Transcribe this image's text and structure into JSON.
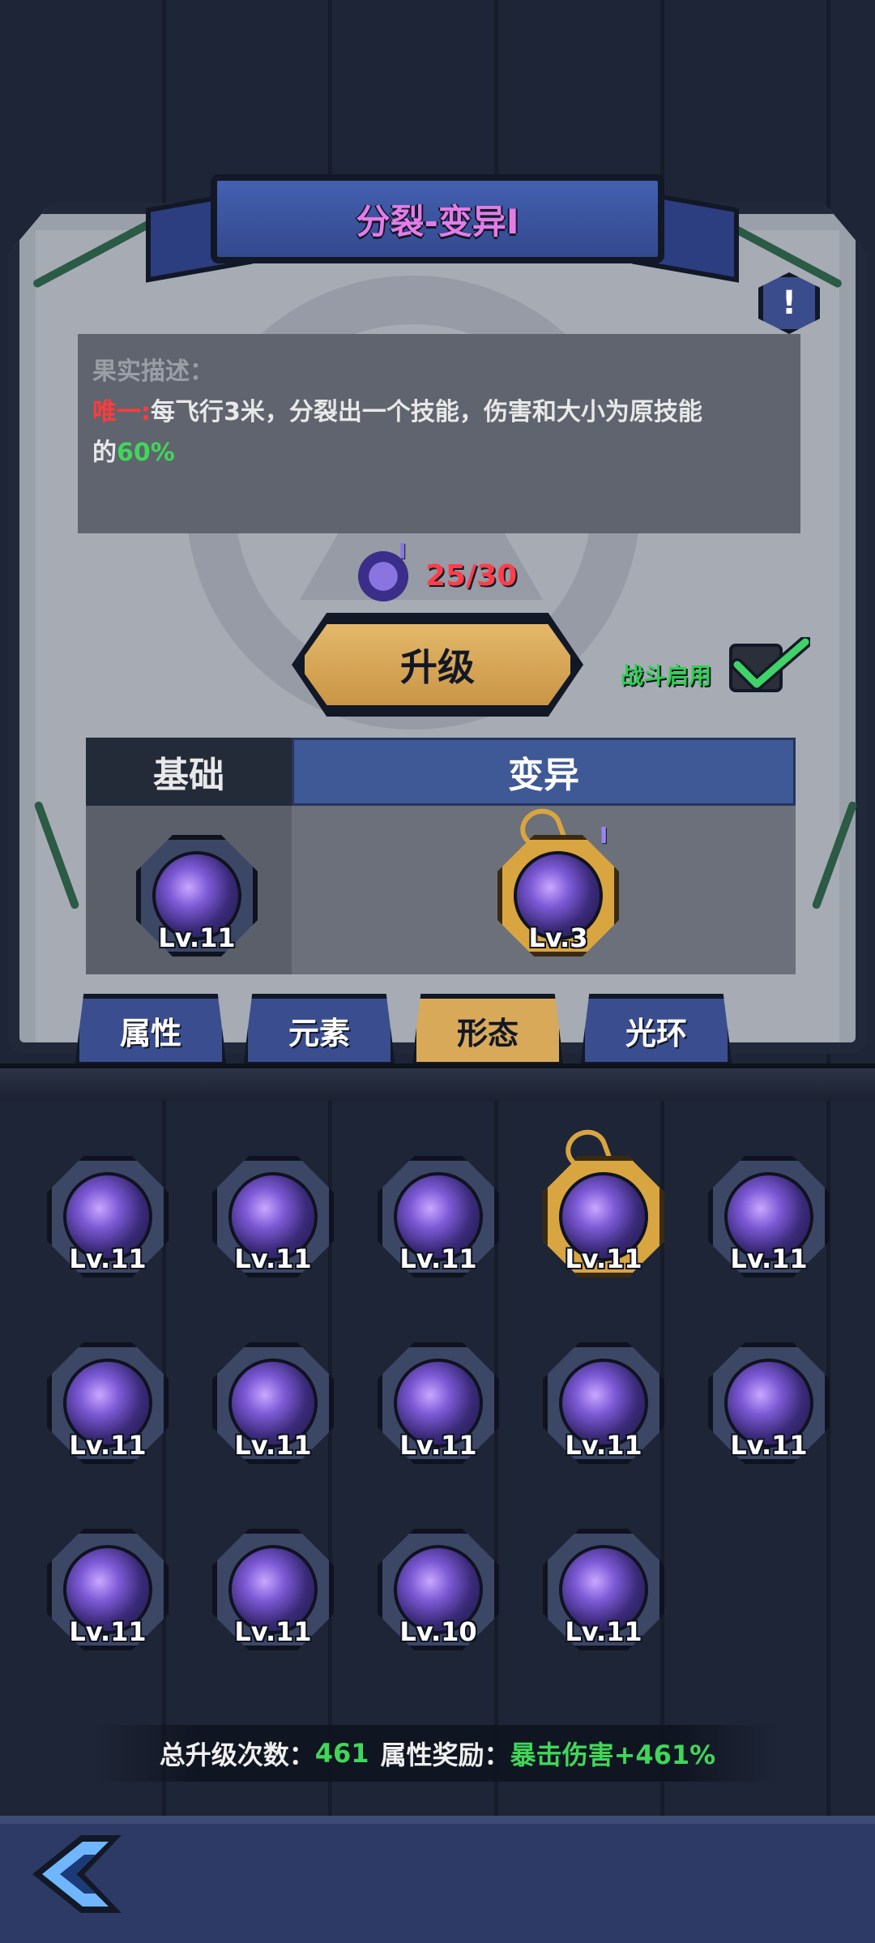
{
  "header": {
    "title": "分裂-变异I",
    "info_icon": "exclamation-icon"
  },
  "description": {
    "heading": "果实描述：",
    "tag": "唯一:",
    "text": "每飞行3米，分裂出一个技能，伤害和大小为原技能",
    "text_end_prefix": "的",
    "highlight": "60%"
  },
  "cost": {
    "icon": "mutation-gem-icon",
    "badge": "I",
    "value": "25/30"
  },
  "upgrade_button": {
    "label": "升级"
  },
  "battle_toggle": {
    "label": "战斗启用",
    "checked": true
  },
  "comparison": {
    "base_header": "基础",
    "mutation_header": "变异",
    "base_level": "Lv.11",
    "mutation_level": "Lv.3",
    "mutation_badge": "I"
  },
  "tabs": [
    {
      "label": "属性",
      "active": false
    },
    {
      "label": "元素",
      "active": false
    },
    {
      "label": "形态",
      "active": true
    },
    {
      "label": "光环",
      "active": false
    }
  ],
  "skills": [
    {
      "level": "Lv.11",
      "selected": false
    },
    {
      "level": "Lv.11",
      "selected": false
    },
    {
      "level": "Lv.11",
      "selected": false
    },
    {
      "level": "Lv.11",
      "selected": true
    },
    {
      "level": "Lv.11",
      "selected": false
    },
    {
      "level": "Lv.11",
      "selected": false
    },
    {
      "level": "Lv.11",
      "selected": false
    },
    {
      "level": "Lv.11",
      "selected": false
    },
    {
      "level": "Lv.11",
      "selected": false
    },
    {
      "level": "Lv.11",
      "selected": false
    },
    {
      "level": "Lv.11",
      "selected": false
    },
    {
      "level": "Lv.11",
      "selected": false
    },
    {
      "level": "Lv.10",
      "selected": false
    },
    {
      "level": "Lv.11",
      "selected": false
    }
  ],
  "summary": {
    "upgrades_label": "总升级次数：",
    "upgrades_value": "461",
    "bonus_label": "属性奖励：",
    "bonus_value": "暴击伤害+461%"
  },
  "colors": {
    "accent_gold": "#d9a95a",
    "tab_blue": "#3a4e8f",
    "green": "#41d65a",
    "red": "#ff3e4a",
    "purple_title": "#e37ce8"
  }
}
